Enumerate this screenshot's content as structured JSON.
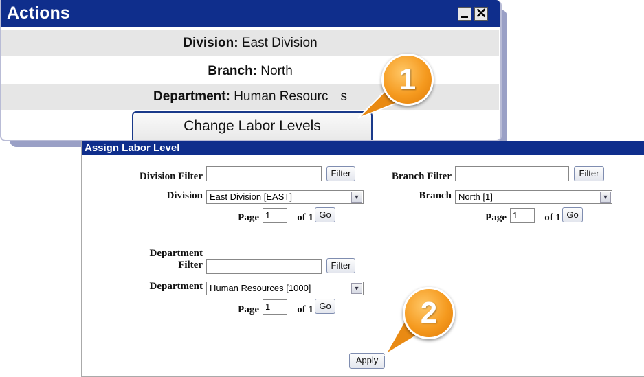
{
  "actions": {
    "title": "Actions",
    "division_label": "Division:",
    "division_value": "East Division",
    "branch_label": "Branch:",
    "branch_value": "North",
    "department_label": "Department:",
    "department_value": "Human Resourc",
    "department_tail": "s",
    "change_button": "Change Labor Levels"
  },
  "assign": {
    "title": "Assign Labor Level",
    "division_filter_label": "Division Filter",
    "division_filter_value": "",
    "division_filter_button": "Filter",
    "division_label": "Division",
    "division_selected": "East Division [EAST]",
    "division_page_label": "Page",
    "division_page_value": "1",
    "division_page_of": "of 1",
    "division_go": "Go",
    "branch_filter_label": "Branch Filter",
    "branch_filter_value": "",
    "branch_filter_button": "Filter",
    "branch_label": "Branch",
    "branch_selected": "North [1]",
    "branch_page_label": "Page",
    "branch_page_value": "1",
    "branch_page_of": "of 1",
    "branch_go": "Go",
    "department_filter_label_1": "Department",
    "department_filter_label_2": "Filter",
    "department_filter_value": "",
    "department_filter_button": "Filter",
    "department_label": "Department",
    "department_selected": "Human Resources [1000]",
    "department_page_label": "Page",
    "department_page_value": "1",
    "department_page_of": "of 1",
    "department_go": "Go",
    "apply_button": "Apply"
  },
  "callouts": [
    "1",
    "2"
  ],
  "colors": {
    "titlebar": "#0f2e8c",
    "callout": "#f59a1f",
    "row_alt": "#e6e6e6"
  }
}
